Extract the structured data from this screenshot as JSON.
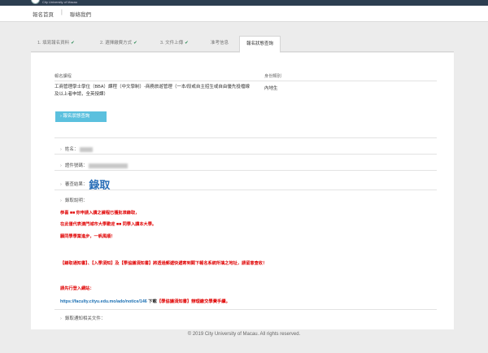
{
  "header": {
    "logo_text": "City University of Macau",
    "nav": [
      "報名首頁",
      "聯絡我們"
    ],
    "nav_separator": "|"
  },
  "steps": [
    {
      "label": "1. 填寫報名資料",
      "done": true
    },
    {
      "label": "2. 選擇繳費方式",
      "done": true
    },
    {
      "label": "3. 文件上傳",
      "done": true
    },
    {
      "label": "准考信息",
      "done": false
    },
    {
      "label": "報名狀態查詢",
      "done": false,
      "active": true
    }
  ],
  "check_mark": "✔",
  "application": {
    "course_label": "報名課程",
    "course_value": "工商管理學士學位（BBA）課程（中文學制）-商務旅遊管理（一本/段或自主招生或自由優先投檔線及以上者申請，全英授課）",
    "identity_label": "身份類別",
    "identity_value": "內地生",
    "query_button": "› 報名狀態查詢"
  },
  "details": {
    "name_label": "姓名：",
    "id_label": "證件號碼：",
    "review_label": "審查結果：",
    "review_value": "錄取",
    "admission_label": "錄取說明：",
    "attachments_label": "錄取通知相关文件："
  },
  "notice": {
    "line1": "恭喜 ■■ 你申請入讀之課程已獲批准錄取，",
    "line2": "在此僅代表澳門城市大學歡迎 ■■ 同學入讀本大學。",
    "line3": "願同學學業進步，一帆風順！",
    "line4": "【錄取通知書】、【入學須知】及【學協議須知書】將透過郵遞快遞寄到閣下報名系統所填之地址，請留意查收！",
    "line5": "請先行登入網站：",
    "link_url": "https://faculty.cityu.edu.mo/ado/notice/146",
    "link_mid": " 下載",
    "link_tail": "【學協議須知書】辦理繳交學費手續。"
  },
  "footer": "© 2019 City University of Macau. All rights reserved.",
  "colors": {
    "accent": "#5bc0de",
    "success": "#2e8b57",
    "alert": "#e00000",
    "link": "#1a6fb3",
    "result": "#2a6fb8"
  }
}
